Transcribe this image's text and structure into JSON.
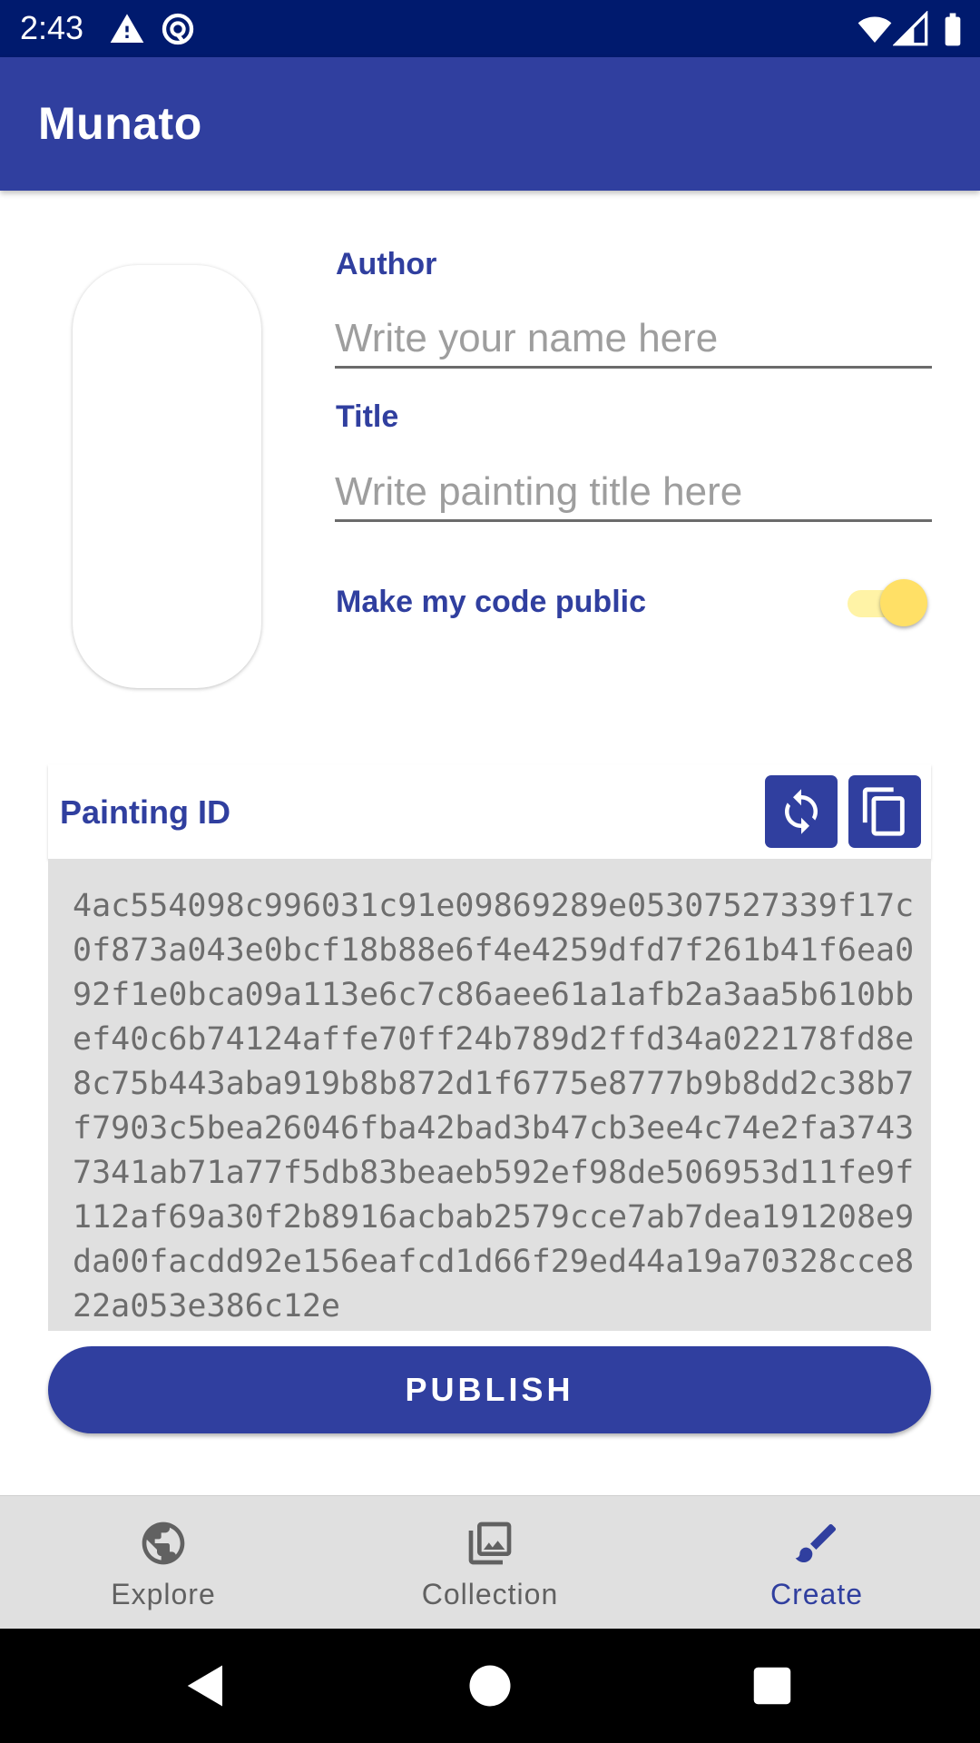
{
  "status_bar": {
    "time": "2:43",
    "icons": [
      "warning-icon",
      "sync-disabled-icon",
      "wifi-icon",
      "signal-icon",
      "battery-icon"
    ]
  },
  "app_bar": {
    "title": "Munato"
  },
  "form": {
    "author_label": "Author",
    "author_placeholder": "Write your name here",
    "title_label": "Title",
    "title_placeholder": "Write painting title here",
    "public_toggle_label": "Make my code public",
    "public_toggle_on": true
  },
  "painting_id": {
    "label": "Painting ID",
    "refresh_icon": "refresh-icon",
    "copy_icon": "copy-icon",
    "code": "4ac554098c996031c91e09869289e05307527339f17c0f873a043e0bcf18b88e6f4e4259dfd7f261b41f6ea092f1e0bca09a113e6c7c86aee61a1afb2a3aa5b610bbef40c6b74124affe70ff24b789d2ffd34a022178fd8e8c75b443aba919b8b872d1f6775e8777b9b8dd2c38b7f7903c5bea26046fba42bad3b47cb3ee4c74e2fa37437341ab71a77f5db83beaeb592ef98de506953d11fe9f112af69a30f2b8916acbab2579cce7ab7dea191208e9da00facdd92e156eafcd1d66f29ed44a19a70328cce822a053e386c12e"
  },
  "publish_button": "PUBLISH",
  "bottom_nav": {
    "items": [
      {
        "label": "Explore",
        "icon": "globe-icon",
        "active": false
      },
      {
        "label": "Collection",
        "icon": "gallery-icon",
        "active": false
      },
      {
        "label": "Create",
        "icon": "brush-icon",
        "active": true
      }
    ]
  },
  "colors": {
    "primary": "#303f9f",
    "status_bar": "#001a6e",
    "toggle_thumb": "#ffe066",
    "code_background": "#e0e0e0",
    "nav_background": "#e0e0e0"
  }
}
